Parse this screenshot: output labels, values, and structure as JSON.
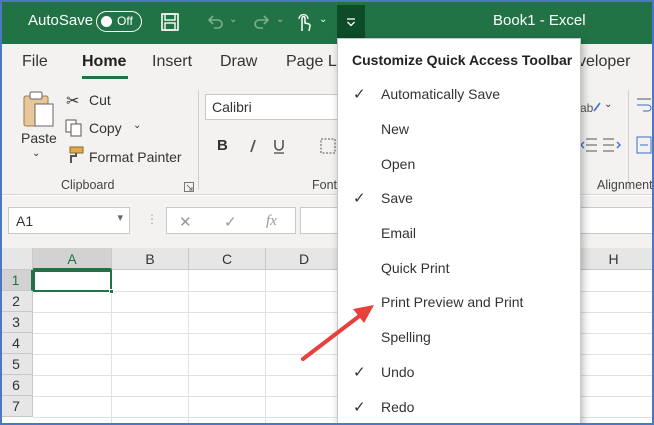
{
  "titlebar": {
    "autosave_label": "AutoSave",
    "autosave_state": "Off",
    "document_title": "Book1  -  Excel",
    "brand_color": "#217346"
  },
  "tabs": [
    "File",
    "Home",
    "Insert",
    "Draw",
    "Page L",
    "veloper"
  ],
  "active_tab": "Home",
  "ribbon": {
    "clipboard": {
      "paste": "Paste",
      "cut": "Cut",
      "copy": "Copy",
      "format_painter": "Format Painter",
      "group_label": "Clipboard"
    },
    "font": {
      "font_name": "Calibri",
      "bold": "B",
      "group_label": "Font"
    },
    "alignment": {
      "group_label": "Alignment"
    }
  },
  "formula_bar": {
    "name_box": "A1",
    "fx_label": "fx"
  },
  "grid": {
    "columns": [
      "A",
      "B",
      "C",
      "D",
      "H"
    ],
    "rows": [
      "1",
      "2",
      "3",
      "4",
      "5",
      "6",
      "7"
    ],
    "active_cell": "A1"
  },
  "menu": {
    "title": "Customize Quick Access Toolbar",
    "items": [
      {
        "label": "Automatically Save",
        "checked": true
      },
      {
        "label": "New",
        "checked": false
      },
      {
        "label": "Open",
        "checked": false
      },
      {
        "label": "Save",
        "checked": true
      },
      {
        "label": "Email",
        "checked": false
      },
      {
        "label": "Quick Print",
        "checked": false
      },
      {
        "label": "Print Preview and Print",
        "checked": false
      },
      {
        "label": "Spelling",
        "checked": false
      },
      {
        "label": "Undo",
        "checked": true
      },
      {
        "label": "Redo",
        "checked": true
      }
    ],
    "check_glyph": "✓"
  },
  "annotation": {
    "arrow_color": "#e8413c"
  }
}
